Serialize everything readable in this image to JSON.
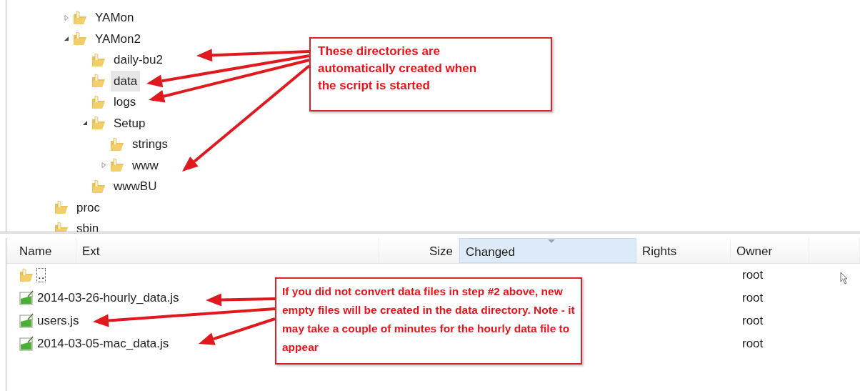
{
  "tree": {
    "items": [
      {
        "children": [
          {
            "label": "YAMon",
            "expander": true,
            "expanded": false,
            "selected": false
          },
          {
            "label": "YAMon2",
            "expander": true,
            "expanded": true,
            "selected": false,
            "children": [
              {
                "label": "daily-bu2",
                "expander": false,
                "selected": false
              },
              {
                "label": "data",
                "expander": false,
                "selected": true
              },
              {
                "label": "logs",
                "expander": false,
                "selected": false
              },
              {
                "label": "Setup",
                "expander": true,
                "expanded": true,
                "selected": false,
                "children": [
                  {
                    "label": "strings",
                    "expander": false,
                    "selected": false
                  },
                  {
                    "label": "www",
                    "expander": true,
                    "expanded": false,
                    "selected": false
                  }
                ]
              },
              {
                "label": "wwwBU",
                "expander": false,
                "selected": false
              }
            ]
          }
        ]
      },
      {
        "label": "proc",
        "expander": false,
        "selected": false
      },
      {
        "label": "sbin",
        "expander": false,
        "selected": false
      }
    ]
  },
  "file_list": {
    "columns": [
      {
        "label": "Name",
        "sorted": false
      },
      {
        "label": "Ext",
        "sorted": false
      },
      {
        "label": "Size",
        "sorted": false
      },
      {
        "label": "Changed",
        "sorted": true
      },
      {
        "label": "Rights",
        "sorted": false
      },
      {
        "label": "Owner",
        "sorted": false
      }
    ],
    "rows": [
      {
        "name": "..",
        "kind": "parent",
        "owner": "root"
      },
      {
        "name": "2014-03-26-hourly_data.js",
        "kind": "file",
        "owner": "root"
      },
      {
        "name": "users.js",
        "kind": "file",
        "owner": "root"
      },
      {
        "name": "2014-03-05-mac_data.js",
        "kind": "file",
        "owner": "root"
      }
    ]
  },
  "callouts": [
    {
      "text": "These directories are automatically created when the script is started"
    },
    {
      "text": "If you did not convert data files in step #2 above, new empty files will be created in the data directory. Note - it may take a couple of minutes for the hourly data file to appear"
    }
  ]
}
